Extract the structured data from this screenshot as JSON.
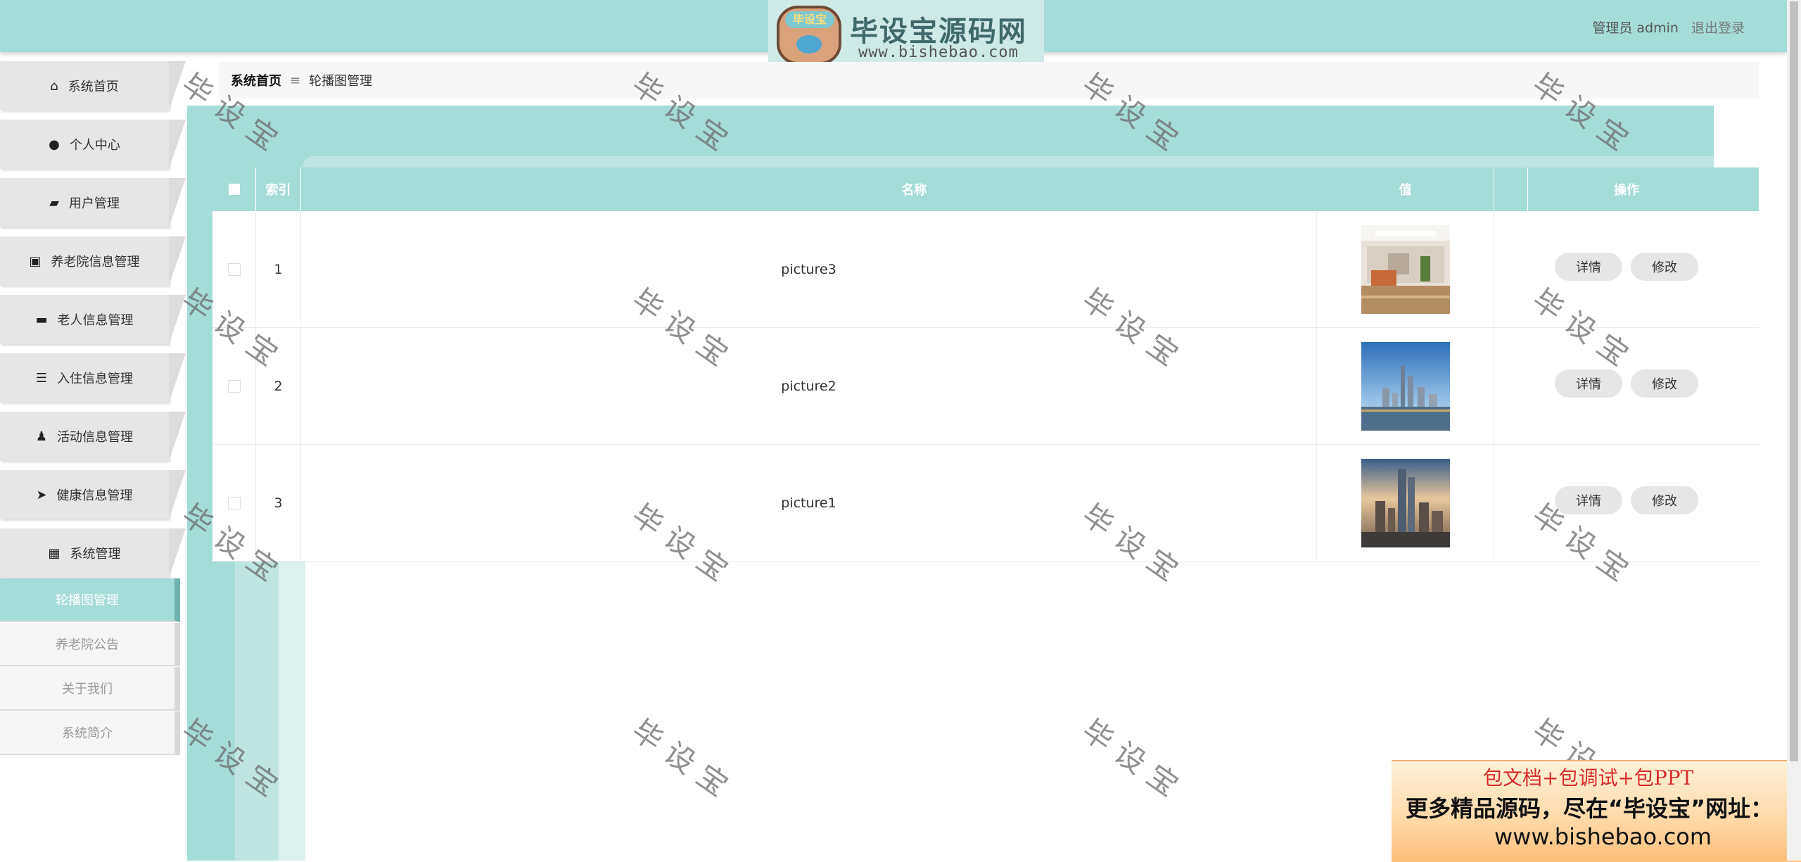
{
  "header": {
    "logo_badge": "毕设宝",
    "logo_title": "毕设宝源码网",
    "logo_url": "www.bishebao.com",
    "user_label": "管理员 admin",
    "logout_label": "退出登录"
  },
  "sidebar": {
    "items": [
      {
        "label": "系统首页",
        "icon": "home-icon"
      },
      {
        "label": "个人中心",
        "icon": "user-icon"
      },
      {
        "label": "用户管理",
        "icon": "wallet-icon"
      },
      {
        "label": "养老院信息管理",
        "icon": "briefcase-icon"
      },
      {
        "label": "老人信息管理",
        "icon": "inbox-icon"
      },
      {
        "label": "入住信息管理",
        "icon": "list-icon"
      },
      {
        "label": "活动信息管理",
        "icon": "person-icon"
      },
      {
        "label": "健康信息管理",
        "icon": "send-icon"
      },
      {
        "label": "系统管理",
        "icon": "grid-icon"
      }
    ],
    "submenu": [
      {
        "label": "轮播图管理",
        "active": true
      },
      {
        "label": "养老院公告",
        "active": false
      },
      {
        "label": "关于我们",
        "active": false
      },
      {
        "label": "系统简介",
        "active": false
      }
    ]
  },
  "breadcrumb": {
    "home": "系统首页",
    "separator": "≡",
    "current": "轮播图管理"
  },
  "table": {
    "headers": {
      "index": "索引",
      "name": "名称",
      "value": "值",
      "ops": "操作"
    },
    "rows": [
      {
        "index": "1",
        "name": "picture3",
        "image": "lobby-photo"
      },
      {
        "index": "2",
        "name": "picture2",
        "image": "city-skyline-photo"
      },
      {
        "index": "3",
        "name": "picture1",
        "image": "city-sunset-photo"
      }
    ],
    "detail_label": "详情",
    "edit_label": "修改"
  },
  "watermark": "毕设宝",
  "ad": {
    "line1": "包文档+包调试+包PPT",
    "line2": "更多精品源码，尽在“毕设宝”网址：",
    "line3": "www.bishebao.com"
  },
  "colors": {
    "accent": "#a4dcd8",
    "accent_light": "#bfe5e2",
    "menu_bg": "#e6e6e6"
  }
}
